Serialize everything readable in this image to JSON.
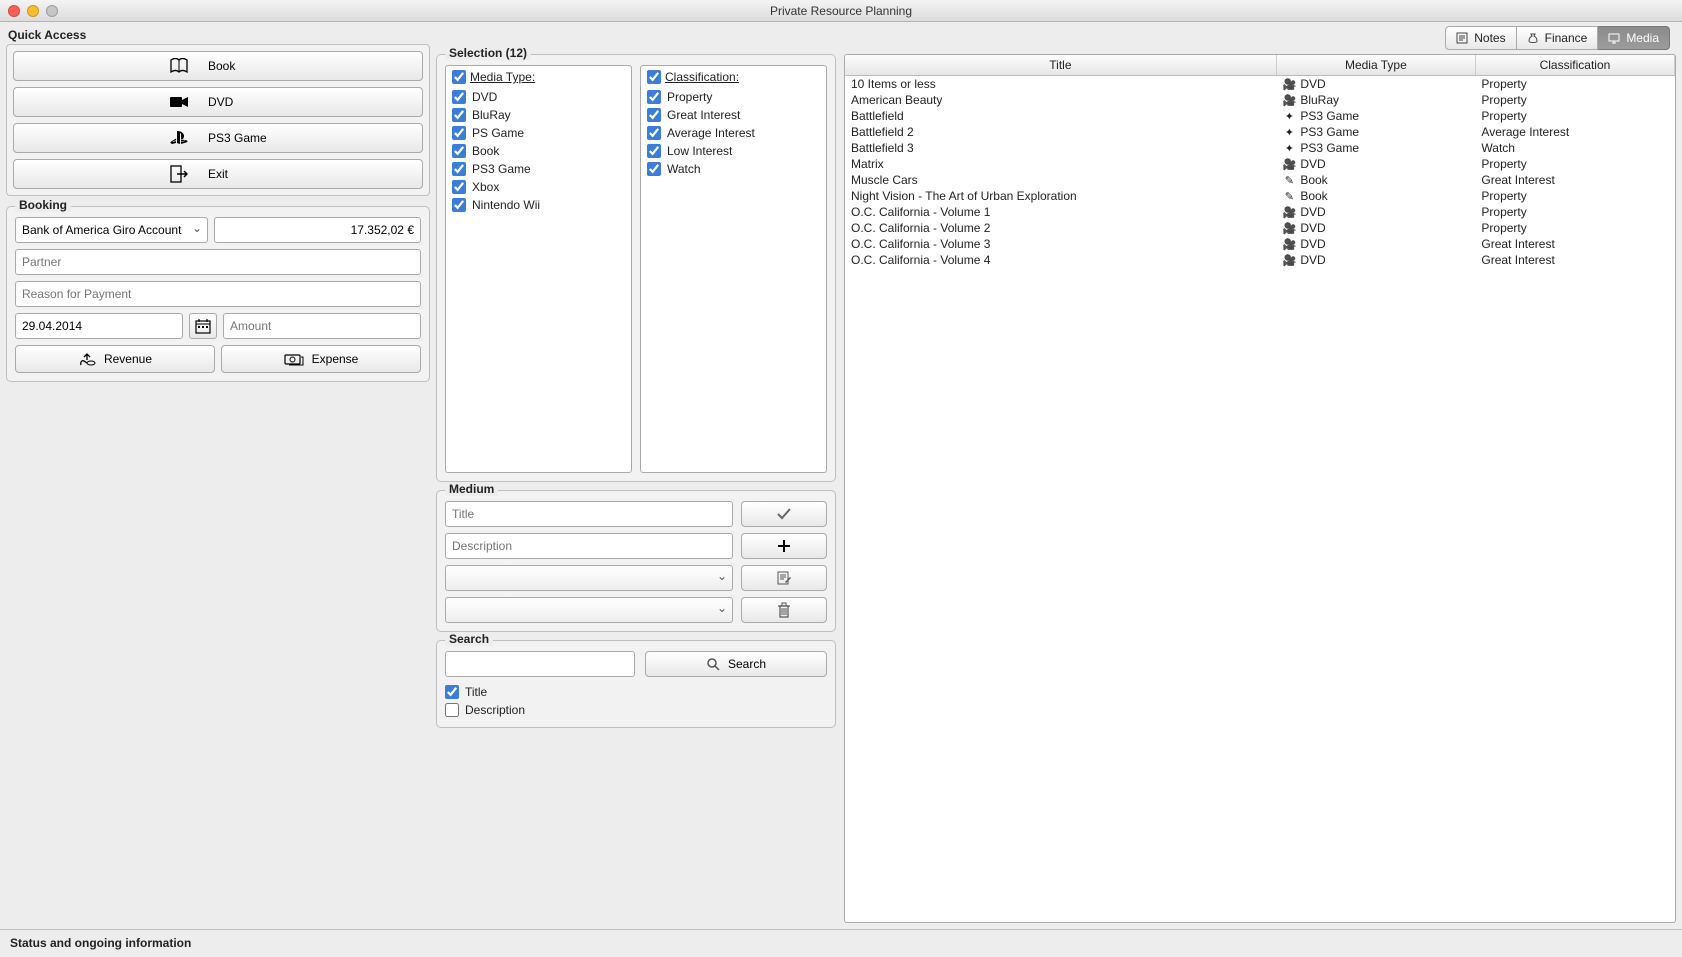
{
  "window": {
    "title": "Private Resource Planning"
  },
  "quick_access": {
    "label": "Quick Access",
    "book": "Book",
    "dvd": "DVD",
    "ps3": "PS3 Game",
    "exit": "Exit"
  },
  "booking": {
    "label": "Booking",
    "account": "Bank of America Giro Account",
    "balance": "17.352,02 €",
    "partner_ph": "Partner",
    "reason_ph": "Reason for Payment",
    "date": "29.04.2014",
    "amount_ph": "Amount",
    "revenue": "Revenue",
    "expense": "Expense"
  },
  "tabs": {
    "notes": "Notes",
    "finance": "Finance",
    "media": "Media"
  },
  "selection": {
    "label": "Selection (12)",
    "media_type_label": "Media Type:",
    "classification_label": "Classification:",
    "media_types": [
      "DVD",
      "BluRay",
      "PS Game",
      "Book",
      "PS3 Game",
      "Xbox",
      "Nintendo Wii"
    ],
    "classifications": [
      "Property",
      "Great Interest",
      "Average Interest",
      "Low Interest",
      "Watch"
    ]
  },
  "medium": {
    "label": "Medium",
    "title_ph": "Title",
    "desc_ph": "Description"
  },
  "search": {
    "label": "Search",
    "button": "Search",
    "opt_title": "Title",
    "opt_desc": "Description"
  },
  "table": {
    "headers": {
      "title": "Title",
      "media_type": "Media Type",
      "classification": "Classification"
    },
    "rows": [
      {
        "title": "10 Items or less",
        "type": "DVD",
        "class": "Property"
      },
      {
        "title": "American Beauty",
        "type": "BluRay",
        "class": "Property"
      },
      {
        "title": "Battlefield",
        "type": "PS3 Game",
        "class": "Property"
      },
      {
        "title": "Battlefield 2",
        "type": "PS3 Game",
        "class": "Average Interest"
      },
      {
        "title": "Battlefield 3",
        "type": "PS3 Game",
        "class": "Watch"
      },
      {
        "title": "Matrix",
        "type": "DVD",
        "class": "Property"
      },
      {
        "title": "Muscle Cars",
        "type": "Book",
        "class": "Great Interest"
      },
      {
        "title": "Night Vision - The Art of Urban Exploration",
        "type": "Book",
        "class": "Property"
      },
      {
        "title": "O.C. California - Volume 1",
        "type": "DVD",
        "class": "Property"
      },
      {
        "title": "O.C. California - Volume 2",
        "type": "DVD",
        "class": "Property"
      },
      {
        "title": "O.C. California - Volume 3",
        "type": "DVD",
        "class": "Great Interest"
      },
      {
        "title": "O.C. California - Volume 4",
        "type": "DVD",
        "class": "Great Interest"
      }
    ]
  },
  "status": "Status and ongoing information"
}
